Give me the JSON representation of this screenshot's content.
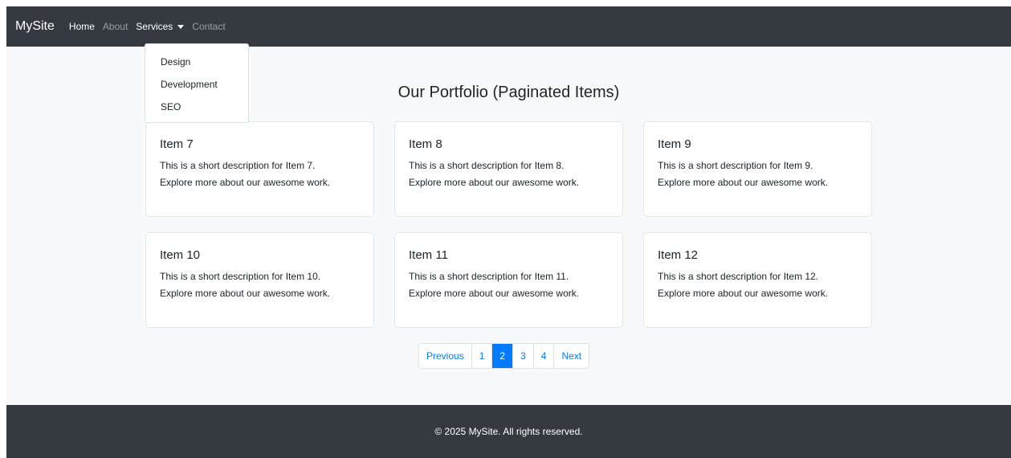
{
  "colors": {
    "navbar_bg": "#343a40",
    "page_bg": "#f8f9fa",
    "accent": "#007bff",
    "footer_bg": "#343a40"
  },
  "navbar": {
    "brand": "MySite",
    "links": [
      {
        "label": "Home",
        "state": "active"
      },
      {
        "label": "About",
        "state": "inactive"
      },
      {
        "label": "Services",
        "state": "open"
      },
      {
        "label": "Contact",
        "state": "inactive"
      }
    ],
    "dropdown_icon": "caret-down-icon"
  },
  "dropdown": {
    "items": [
      "Design",
      "Development",
      "SEO"
    ]
  },
  "main": {
    "title": "Our Portfolio (Paginated Items)",
    "cards": [
      {
        "title": "Item 7",
        "line1": "This is a short description for Item 7.",
        "line2": "Explore more about our awesome work."
      },
      {
        "title": "Item 8",
        "line1": "This is a short description for Item 8.",
        "line2": "Explore more about our awesome work."
      },
      {
        "title": "Item 9",
        "line1": "This is a short description for Item 9.",
        "line2": "Explore more about our awesome work."
      },
      {
        "title": "Item 10",
        "line1": "This is a short description for Item 10.",
        "line2": "Explore more about our awesome work."
      },
      {
        "title": "Item 11",
        "line1": "This is a short description for Item 11.",
        "line2": "Explore more about our awesome work."
      },
      {
        "title": "Item 12",
        "line1": "This is a short description for Item 12.",
        "line2": "Explore more about our awesome work."
      }
    ]
  },
  "pagination": {
    "previous": "Previous",
    "pages": [
      "1",
      "2",
      "3",
      "4"
    ],
    "current": "2",
    "next": "Next"
  },
  "footer": {
    "text": "© 2025 MySite. All rights reserved."
  }
}
